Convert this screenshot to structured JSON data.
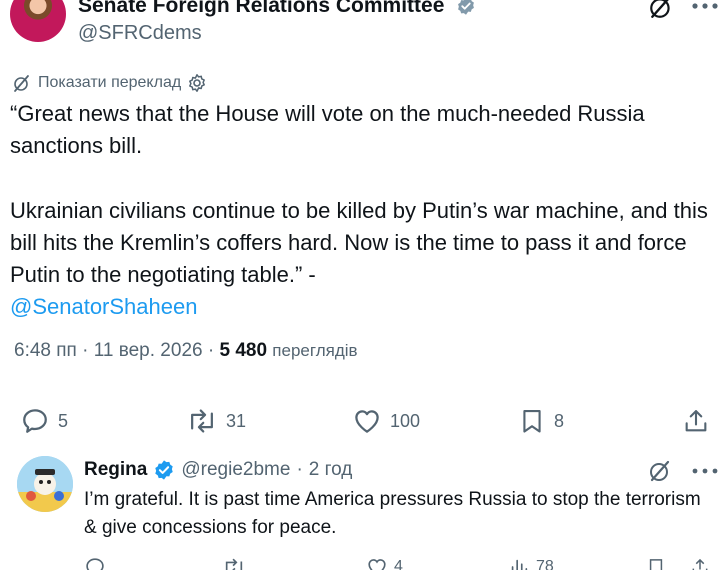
{
  "tweet": {
    "author_name": "Senate Foreign Relations Committee",
    "author_handle": "@SFRCdems",
    "translate_label": "Показати переклад",
    "text_line1": "“Great news that the House will vote on the much-needed Russia sanctions bill.",
    "text_line2": "Ukrainian civilians continue to be killed by Putin’s war machine, and this bill hits the Kremlin’s coffers hard. Now is the time to pass it and force Putin to the negotiating table.” -",
    "mention": "@SenatorShaheen",
    "time": "6:48 пп",
    "separator1": "·",
    "date": "11 вер. 2026",
    "separator2": "·",
    "views_count": "5 480",
    "views_label": "переглядів",
    "replies": "5",
    "reposts": "31",
    "likes": "100",
    "bookmarks": "8"
  },
  "reply": {
    "author_name": "Regina",
    "author_handle": "@regie2bme",
    "separator": "·",
    "time": "2 год",
    "text": "I’m grateful. It is past time America pressures Russia to stop the terrorism & give concessions for peace.",
    "likes_partial": "4",
    "views_partial": "78"
  },
  "colors": {
    "accent": "#1d9bf0",
    "text_primary": "#0f1419",
    "text_secondary": "#536471",
    "verified_gray": "#829aab"
  }
}
